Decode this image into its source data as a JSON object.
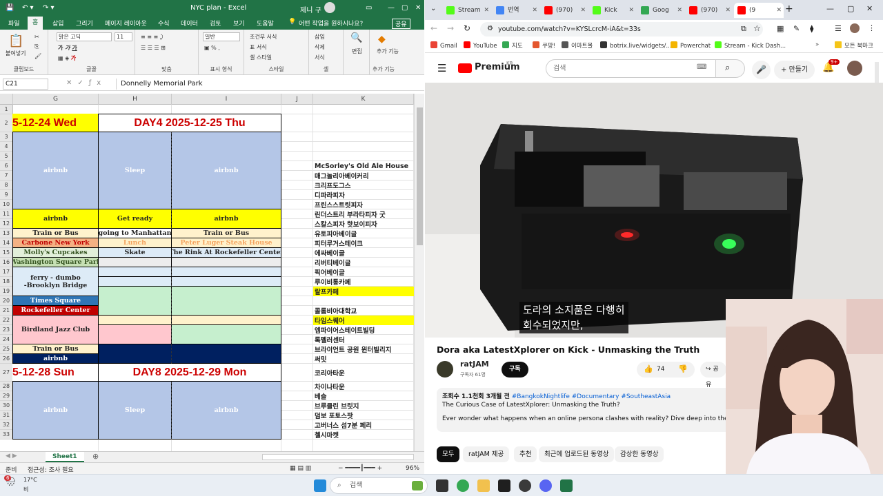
{
  "excel": {
    "title": "NYC plan  -  Excel",
    "user": "제니 구",
    "ribbon_tabs": [
      "파일",
      "홈",
      "삽입",
      "그리기",
      "페이지 레이아웃",
      "수식",
      "데이터",
      "검토",
      "보기",
      "도움말"
    ],
    "tell_me": "어떤 작업을 원하시나요?",
    "share": "공유",
    "font_name": "맑은 고딕",
    "font_size": "11",
    "number_format": "일반",
    "groups": {
      "clipboard": "클립보드",
      "font": "글꼴",
      "align": "맞춤",
      "number": "표시 형식",
      "style": "스타일",
      "cells": "셀",
      "edit": "편집",
      "addins": "추가 기능"
    },
    "paste": "붙여넣기",
    "cond_format": "조건부 서식",
    "table_format": "표 서식",
    "cell_style": "셀 스타일",
    "insert": "삽입",
    "delete": "삭제",
    "format": "서식",
    "edit_btn": "편집",
    "addins_btn": "추가 기능",
    "name_box": "C21",
    "formula": "Donnelly Memorial Park",
    "columns": [
      "G",
      "H",
      "I",
      "J",
      "K"
    ],
    "rows": [
      "1",
      "2",
      "3",
      "4",
      "5",
      "6",
      "7",
      "8",
      "9",
      "10",
      "11",
      "12",
      "13",
      "14",
      "15",
      "16",
      "17",
      "18",
      "19",
      "20",
      "21",
      "22",
      "23",
      "24",
      "25",
      "26",
      "27",
      "28",
      "29",
      "30",
      "31",
      "32",
      "33"
    ],
    "day3": "5-12-24 Wed",
    "day4": "DAY4  2025-12-25 Thu",
    "day7": "5-12-28 Sun",
    "day8": "DAY8  2025-12-29 Mon",
    "airbnb": "airbnb",
    "sleep": "Sleep",
    "get_ready": "Get ready",
    "train_or_bus": "Train or Bus",
    "going_manhattan": "going to Manhattan",
    "carbone": "Carbone New York",
    "lunch": "Lunch",
    "peter_luger": "Peter Luger Steak House",
    "mollys": "Molly's Cupcakes",
    "skate": "Skate",
    "rink": "The Rink At Rockefeller Center",
    "washington": "Washington Square Park",
    "ferry_l1": "ferry - dumbo",
    "ferry_l2": "-Brooklyn Bridge",
    "times_square": "Times Square",
    "rockefeller": "Rockefeller Center",
    "birdland": "Birdland Jazz Club",
    "k_list": [
      {
        "row": 6,
        "text": "McSorley's Old Ale House"
      },
      {
        "row": 7,
        "text": "매그놀리아베이커리"
      },
      {
        "row": 8,
        "text": "크리프도그스"
      },
      {
        "row": 9,
        "text": "디파라피자"
      },
      {
        "row": 10,
        "text": "프린스스트릿피자"
      },
      {
        "row": 11,
        "text": "린더스트리 부라타피자 굿"
      },
      {
        "row": 12,
        "text": "스칼스피자 핫보이피자"
      },
      {
        "row": 13,
        "text": "유토피아베이글"
      },
      {
        "row": 14,
        "text": "피터루거스테이크"
      },
      {
        "row": 15,
        "text": "에싸베이글"
      },
      {
        "row": 16,
        "text": "리버티베이글"
      },
      {
        "row": 17,
        "text": "픽어베이글"
      },
      {
        "row": 18,
        "text": "루이비통카페"
      },
      {
        "row": 19,
        "text": "랄프카페"
      },
      {
        "row": 21,
        "text": "콜롬비아대학교"
      },
      {
        "row": 22,
        "text": "타임스퀘어"
      },
      {
        "row": 23,
        "text": "엠파이어스테이트빌딩"
      },
      {
        "row": 24,
        "text": "록펠러센터"
      },
      {
        "row": 25,
        "text": "브라이언트 공원 윈터빌리지"
      },
      {
        "row": 26,
        "text": "써밋"
      },
      {
        "row": 27,
        "text": "코리아타운"
      },
      {
        "row": 28,
        "text": "차이나타운"
      },
      {
        "row": 29,
        "text": "베슬"
      },
      {
        "row": 30,
        "text": "브루클린 브릿지"
      },
      {
        "row": 31,
        "text": "덤보 포토스팟"
      },
      {
        "row": 32,
        "text": "고버너스 섬7분 페리"
      },
      {
        "row": 33,
        "text": "첼시마켓"
      }
    ],
    "sheet_tab": "Sheet1",
    "status_ready": "준비",
    "status_access": "접근성: 조사 필요",
    "zoom": "96%"
  },
  "browser": {
    "tabs": [
      {
        "label": "Stream",
        "color": "#53fc18"
      },
      {
        "label": "번역",
        "color": "#4285f4"
      },
      {
        "label": "(970)",
        "color": "#ff0000"
      },
      {
        "label": "Kick",
        "color": "#53fc18"
      },
      {
        "label": "Goog",
        "color": "#34a853"
      },
      {
        "label": "(970)",
        "color": "#ff0000"
      },
      {
        "label": "(9",
        "color": "#ff0000"
      }
    ],
    "url": "youtube.com/watch?v=KYSLcrcM-iA&t=33s",
    "bookmarks": [
      "Gmail",
      "YouTube",
      "지도",
      "쿠팡!",
      "이마트몰",
      "botrix.live/widgets/...",
      "Powerchat",
      "Stream - Kick Dash..."
    ],
    "all_bookmarks": "모든 북마크",
    "yt_logo": "Premium",
    "yt_region": "KR",
    "search_placeholder": "검색",
    "create": "만들기",
    "notif_badge": "9+",
    "subtitle_l1": "도라의 소지품은 다행히",
    "subtitle_l2": "회수되었지만,",
    "video_title": "Dora aka LatestXplorer on Kick - Unmasking the Truth",
    "channel": "ratJAM",
    "subscribers": "구독자 61명",
    "subscribe": "구독",
    "likes": "74",
    "share": "공유",
    "views_meta": "조회수 1.1천회  3개월 전",
    "hashtags": "#BangkokNightlife #Documentary #SoutheastAsia",
    "desc_l1": "The Curious Case of LatestXplorer: Unmasking the Truth?",
    "desc_l2": "Ever wonder what happens when an online persona clashes with reality? Dive deep into the perplexing",
    "chips": [
      "모두",
      "ratJAM 제공",
      "추천",
      "최근에 업로드된 동영상",
      "감상한 동영상"
    ]
  },
  "taskbar": {
    "weather_temp": "17°C",
    "weather_desc": "비",
    "weather_badge": "6",
    "search": "검색"
  }
}
